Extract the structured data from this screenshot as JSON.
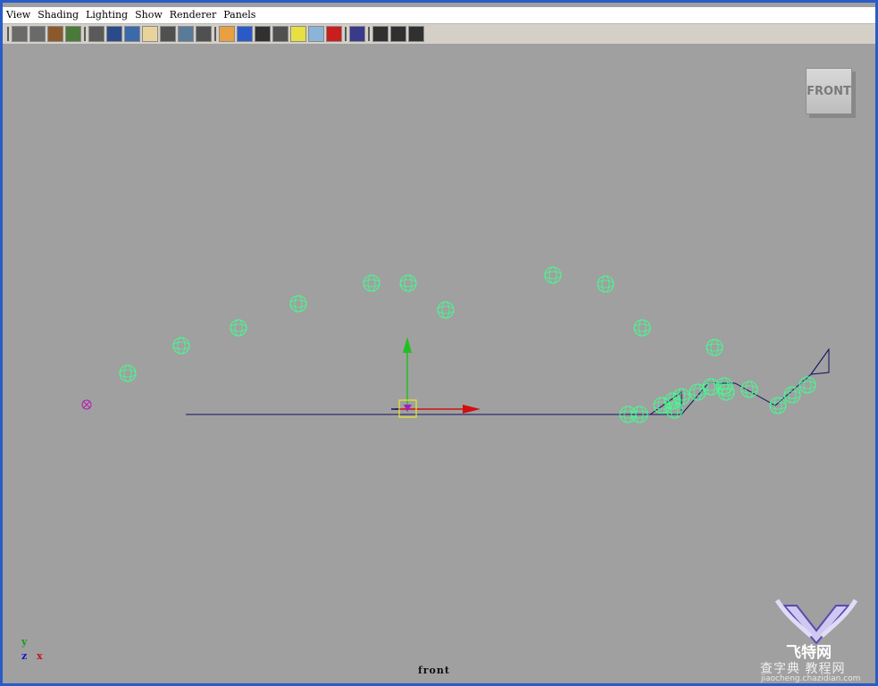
{
  "menu": [
    "View",
    "Shading",
    "Lighting",
    "Show",
    "Renderer",
    "Panels"
  ],
  "toolbar": {
    "groups": [
      [
        "camera-select-icon",
        "camera-attributes-icon",
        "bookmark-icon",
        "image-plane-icon"
      ],
      [
        "grid-icon",
        "film-gate-icon",
        "resolution-gate-icon",
        "gate-mask-icon",
        "field-chart-icon",
        "safe-action-icon",
        "safe-title-icon"
      ],
      [
        "wireframe-icon",
        "smooth-shade-icon",
        "flat-shade-icon",
        "bounding-box-icon",
        "use-default-light-icon",
        "xray-icon",
        "isolate-select-icon"
      ],
      [
        "frame-selection-icon"
      ],
      [
        "wireframe-on-shaded-icon",
        "textured-icon",
        "hud-icon"
      ]
    ],
    "colors": [
      "#6a6a6a",
      "#6a6a6a",
      "#8b5a2b",
      "#4a7a3a",
      "#5a5a5a",
      "#2a4a8a",
      "#3a6aaa",
      "#e8d49a",
      "#505050",
      "#5a7a9a",
      "#505050",
      "#e8a040",
      "#2a5ac8",
      "#303030",
      "#505050",
      "#e8e040",
      "#8ab4d8",
      "#c81e1e",
      "#3a3a8a",
      "#303030",
      "#303030",
      "#303030"
    ]
  },
  "view_cube": {
    "label": "FRONT"
  },
  "camera_name": "front",
  "axis_indicator": {
    "y": "y",
    "z": "z",
    "x": "x"
  },
  "watermark": {
    "brand": "飞特网",
    "site_cn": "查字典 教程网",
    "site_url": "jiaocheng.chazidian.com"
  }
}
